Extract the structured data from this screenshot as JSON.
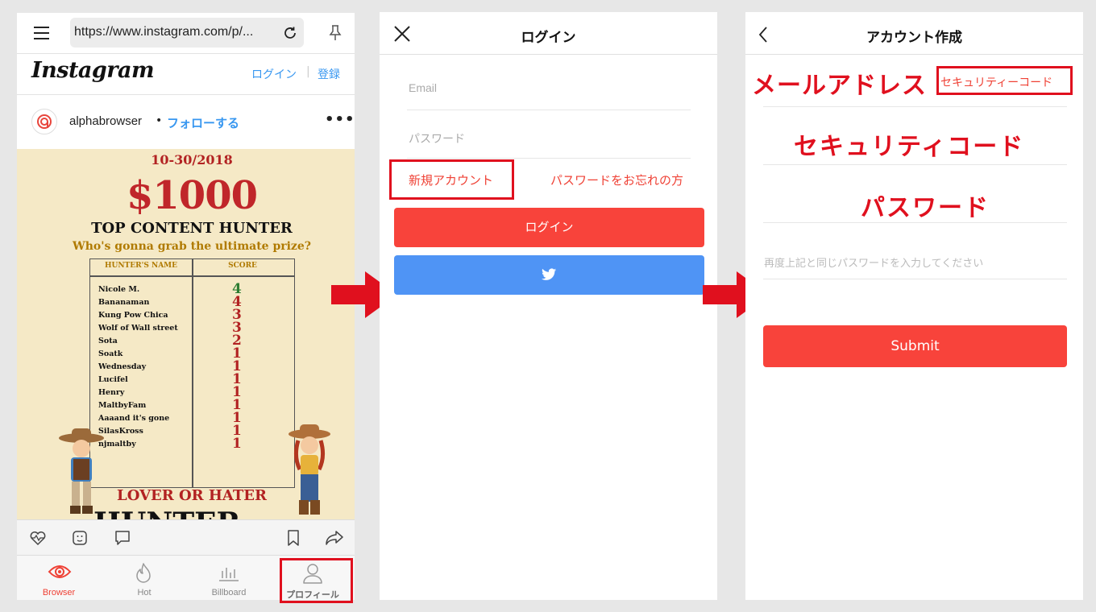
{
  "browser": {
    "url": "https://www.instagram.com/p/...",
    "logo_text": "Instagram",
    "login_link": "ログイン",
    "divider": "|",
    "signup_link": "登録",
    "post_username": "alphabrowser",
    "post_dot": "•",
    "follow_label": "フォローする",
    "more_label": "•••",
    "poster": {
      "date": "10-30/2018",
      "prize": "$1000",
      "headline": "TOP CONTENT HUNTER",
      "subheadline": "Who's gonna grab the ultimate prize?",
      "col_name": "HUNTER'S NAME",
      "col_score": "SCORE",
      "rows": [
        {
          "name": "Nicole M.",
          "score": "4"
        },
        {
          "name": "Bananaman",
          "score": "4"
        },
        {
          "name": "Kung Pow Chica",
          "score": "3"
        },
        {
          "name": "Wolf of Wall street",
          "score": "3"
        },
        {
          "name": "Sota",
          "score": "2"
        },
        {
          "name": "Soatk",
          "score": "1"
        },
        {
          "name": "Wednesday",
          "score": "1"
        },
        {
          "name": "Lucifel",
          "score": "1"
        },
        {
          "name": "Henry",
          "score": "1"
        },
        {
          "name": "MaltbyFam",
          "score": "1"
        },
        {
          "name": "Aaaand it's gone",
          "score": "1"
        },
        {
          "name": "SilasKross",
          "score": "1"
        },
        {
          "name": "njmaltby",
          "score": "1"
        }
      ],
      "footer": "LOVER OR HATER",
      "footer2": "HUNTER"
    },
    "tabs": [
      {
        "label": "Browser",
        "active": true
      },
      {
        "label": "Hot",
        "active": false
      },
      {
        "label": "Billboard",
        "active": false
      },
      {
        "label": "プロフィール",
        "active": false
      }
    ]
  },
  "login": {
    "title": "ログイン",
    "email_placeholder": "Email",
    "password_placeholder": "パスワード",
    "new_account": "新規アカウント",
    "forgot_password": "パスワードをお忘れの方",
    "login_button": "ログイン"
  },
  "signup": {
    "title": "アカウント作成",
    "email_annotation": "メールアドレス",
    "security_code_button": "セキュリティーコード",
    "security_code_annotation": "セキュリティコード",
    "password_annotation": "パスワード",
    "confirm_placeholder": "再度上記と同じパスワードを入力してください",
    "submit": "Submit"
  },
  "colors": {
    "accent_red": "#ef4135",
    "annotation_red": "#e0101e",
    "link_blue": "#3897f0",
    "twitter_blue": "#4f94f5"
  }
}
